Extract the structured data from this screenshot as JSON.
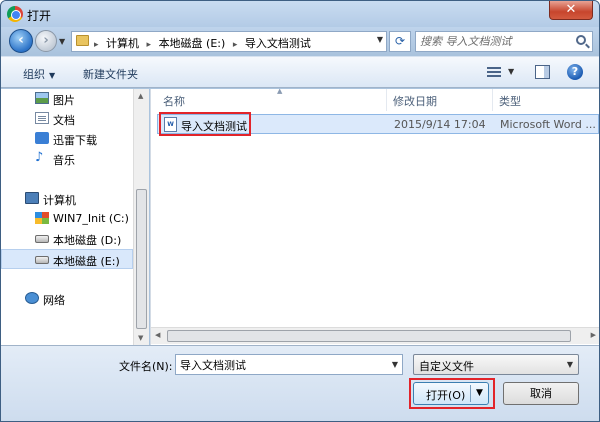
{
  "window": {
    "title": "打开",
    "close_label": "✕"
  },
  "address": {
    "breadcrumbs": [
      "计算机",
      "本地磁盘 (E:)",
      "导入文档测试"
    ],
    "separator": "▸",
    "search_placeholder": "搜索 导入文档测试"
  },
  "toolbar": {
    "organize_label": "组织",
    "new_folder_label": "新建文件夹"
  },
  "nav": {
    "items": [
      {
        "label": "图片",
        "icon": "pictures-icon"
      },
      {
        "label": "文档",
        "icon": "documents-icon"
      },
      {
        "label": "迅雷下载",
        "icon": "thunder-download-icon"
      },
      {
        "label": "音乐",
        "icon": "music-icon"
      },
      {
        "label": "计算机",
        "icon": "computer-icon"
      },
      {
        "label": "WIN7_Init (C:)",
        "icon": "windows-drive-icon"
      },
      {
        "label": "本地磁盘 (D:)",
        "icon": "drive-icon"
      },
      {
        "label": "本地磁盘 (E:)",
        "icon": "drive-icon",
        "selected": true
      },
      {
        "label": "网络",
        "icon": "network-icon"
      }
    ]
  },
  "filelist": {
    "columns": {
      "name": "名称",
      "date": "修改日期",
      "type": "类型"
    },
    "rows": [
      {
        "name": "导入文档测试",
        "date": "2015/9/14 17:04",
        "type": "Microsoft Word ..."
      }
    ],
    "file_icon_text": "W"
  },
  "footer": {
    "filename_label": "文件名(N):",
    "filename_value": "导入文档测试",
    "filter_value": "自定义文件",
    "open_label": "打开(O)",
    "cancel_label": "取消"
  },
  "colors": {
    "highlight": "#e2242a",
    "selection": "#dbe9fb",
    "frame": "#aac3dd"
  }
}
